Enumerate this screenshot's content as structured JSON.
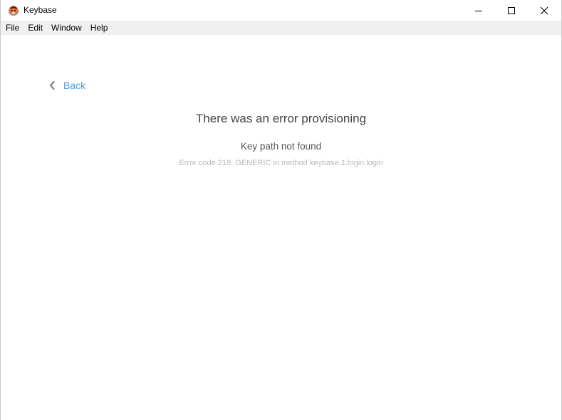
{
  "window": {
    "title": "Keybase",
    "app_icon": "keybase-logo-icon"
  },
  "menu": {
    "items": [
      {
        "label": "File"
      },
      {
        "label": "Edit"
      },
      {
        "label": "Window"
      },
      {
        "label": "Help"
      }
    ]
  },
  "nav": {
    "back_label": "Back",
    "back_icon": "chevron-left-icon"
  },
  "error": {
    "title": "There was an error provisioning",
    "message": "Key path not found",
    "detail": "Error code 218: GENERIC in method keybase.1.login.login"
  },
  "colors": {
    "link": "#4a9be8",
    "title_text": "#444444",
    "detail_text": "#b8b8b8",
    "menubar_bg": "#f0f0f0"
  }
}
